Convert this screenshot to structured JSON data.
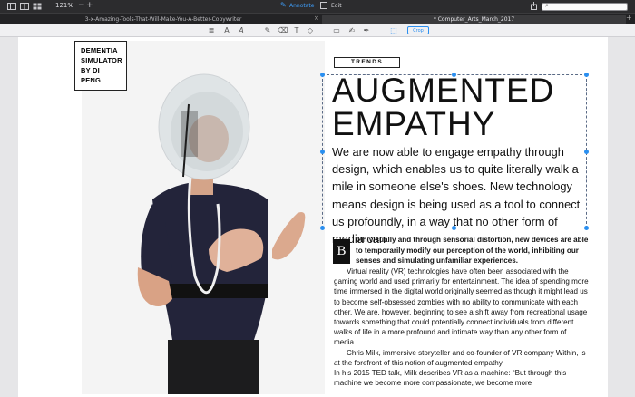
{
  "toolbar": {
    "zoom": "121%",
    "annotate_label": "Annotate",
    "edit_label": "Edit",
    "crop_label": "Crop"
  },
  "tabs": [
    {
      "label": "3-x-Amazing-Tools-That-Will-Make-You-A-Better-Copywriter",
      "active": false
    },
    {
      "label": "* Computer_Arts_March_2017",
      "active": true
    }
  ],
  "article": {
    "caption": [
      "DEMENTIA",
      "SIMULATOR",
      "BY DI PENG"
    ],
    "section": "TRENDS",
    "headline": [
      "AUGMENTED",
      "EMPATHY"
    ],
    "lead": "We are now able to engage empathy through design, which enables us to quite literally walk a mile in someone else's shoes. New technology means design is being used as a tool to connect us profoundly, in a way that no other form of media can",
    "dropcap": "B",
    "intro": "oth visually and through sensorial distortion, new devices are able to temporarily modify our perception of the world, inhibiting our senses and simulating unfamiliar experiences.",
    "body": [
      "Virtual reality (VR) technologies have often been associated with the gaming world and used primarily for entertainment. The idea of spending more time immersed in the digital world originally seemed as though it might lead us to become self-obsessed zombies with no ability to communicate with each other. We are, however, beginning to see a shift away from recreational usage towards something that could potentially connect individuals from different walks of life in a more profound and intimate way than any other form of media.",
      "Chris Milk, immersive storyteller and co-founder of VR company Within, is at the forefront of this notion of augmented empathy.",
      "In his 2015 TED talk, Milk describes VR as a machine: “But through this machine we become more compassionate, we become more"
    ]
  },
  "icons": {
    "sidebar": "sidebar-icon",
    "thumbnails": "thumbnails-icon",
    "zoom_out": "zoom-out-icon",
    "zoom_in": "zoom-in-icon",
    "annotate": "pen-icon",
    "edit": "edit-icon",
    "share": "share-icon",
    "search": "search-icon"
  },
  "colors": {
    "accent": "#2a8ff0",
    "text": "#111111",
    "chrome": "#2c2c2e"
  }
}
